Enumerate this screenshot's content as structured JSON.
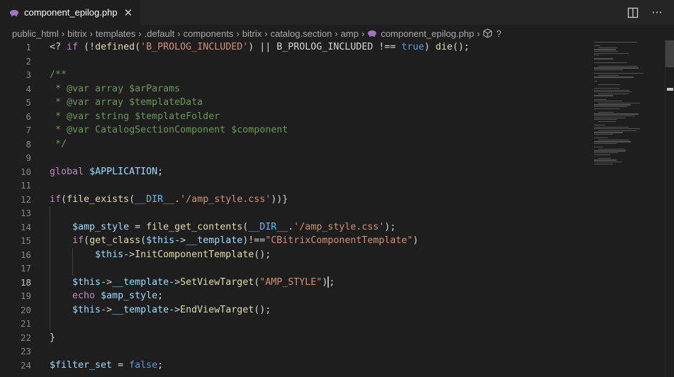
{
  "tab": {
    "label": "component_epilog.php",
    "close": "✕"
  },
  "actions": {
    "split": "split-editor",
    "more": "···"
  },
  "breadcrumb": [
    "public_html",
    "bitrix",
    "templates",
    ".default",
    "components",
    "bitrix",
    "catalog.section",
    "amp",
    "component_epilog.php",
    "?"
  ],
  "lines": [
    {
      "n": "1",
      "tokens": [
        [
          "plain",
          "<? "
        ],
        [
          "kw",
          "if"
        ],
        [
          "plain",
          " (!"
        ],
        [
          "fn",
          "defined"
        ],
        [
          "plain",
          "("
        ],
        [
          "str",
          "'B_PROLOG_INCLUDED'"
        ],
        [
          "plain",
          ") || B_PROLOG_INCLUDED !== "
        ],
        [
          "bool",
          "true"
        ],
        [
          "plain",
          ") "
        ],
        [
          "fn",
          "die"
        ],
        [
          "plain",
          "();"
        ]
      ]
    },
    {
      "n": "2",
      "tokens": []
    },
    {
      "n": "3",
      "tokens": [
        [
          "com",
          "/**"
        ]
      ]
    },
    {
      "n": "4",
      "tokens": [
        [
          "com",
          " * @var array $arParams"
        ]
      ]
    },
    {
      "n": "5",
      "tokens": [
        [
          "com",
          " * @var array $templateData"
        ]
      ]
    },
    {
      "n": "6",
      "tokens": [
        [
          "com",
          " * @var string $templateFolder"
        ]
      ]
    },
    {
      "n": "7",
      "tokens": [
        [
          "com",
          " * @var CatalogSectionComponent $component"
        ]
      ]
    },
    {
      "n": "8",
      "tokens": [
        [
          "com",
          " */"
        ]
      ]
    },
    {
      "n": "9",
      "tokens": []
    },
    {
      "n": "10",
      "tokens": [
        [
          "kw",
          "global"
        ],
        [
          "plain",
          " "
        ],
        [
          "var",
          "$APPLICATION"
        ],
        [
          "plain",
          ";"
        ]
      ]
    },
    {
      "n": "11",
      "tokens": []
    },
    {
      "n": "12",
      "tokens": [
        [
          "kw",
          "if"
        ],
        [
          "plain",
          "("
        ],
        [
          "fn",
          "file_exists"
        ],
        [
          "plain",
          "("
        ],
        [
          "cons",
          "__DIR__"
        ],
        [
          "plain",
          "."
        ],
        [
          "str",
          "'/amp_style.css'"
        ],
        [
          "plain",
          "))}"
        ]
      ]
    },
    {
      "n": "13",
      "tokens": []
    },
    {
      "n": "14",
      "tokens": [
        [
          "plain",
          "    "
        ],
        [
          "var",
          "$amp_style"
        ],
        [
          "plain",
          " = "
        ],
        [
          "fn",
          "file_get_contents"
        ],
        [
          "plain",
          "("
        ],
        [
          "cons",
          "__DIR__"
        ],
        [
          "plain",
          "."
        ],
        [
          "str",
          "'/amp_style.css'"
        ],
        [
          "plain",
          ");"
        ]
      ]
    },
    {
      "n": "15",
      "tokens": [
        [
          "plain",
          "    "
        ],
        [
          "kw",
          "if"
        ],
        [
          "plain",
          "("
        ],
        [
          "fn",
          "get_class"
        ],
        [
          "plain",
          "("
        ],
        [
          "var",
          "$this"
        ],
        [
          "plain",
          "->"
        ],
        [
          "var",
          "__template"
        ],
        [
          "plain",
          ")!=="
        ],
        [
          "str",
          "\"CBitrixComponentTemplate\""
        ],
        [
          "plain",
          ")"
        ]
      ]
    },
    {
      "n": "16",
      "tokens": [
        [
          "plain",
          "        "
        ],
        [
          "var",
          "$this"
        ],
        [
          "plain",
          "->"
        ],
        [
          "fn",
          "InitComponentTemplate"
        ],
        [
          "plain",
          "();"
        ]
      ]
    },
    {
      "n": "17",
      "tokens": []
    },
    {
      "n": "18",
      "tokens": [
        [
          "plain",
          "    "
        ],
        [
          "var",
          "$this"
        ],
        [
          "plain",
          "->"
        ],
        [
          "var",
          "__template"
        ],
        [
          "plain",
          "->"
        ],
        [
          "fn",
          "SetViewTarget"
        ],
        [
          "plain",
          "("
        ],
        [
          "str",
          "\"AMP_STYLE\""
        ],
        [
          "plain",
          ")"
        ],
        [
          "cursor",
          ""
        ],
        [
          "plain",
          ";"
        ]
      ]
    },
    {
      "n": "19",
      "tokens": [
        [
          "plain",
          "    "
        ],
        [
          "kw",
          "echo"
        ],
        [
          "plain",
          " "
        ],
        [
          "var",
          "$amp_style"
        ],
        [
          "plain",
          ";"
        ]
      ]
    },
    {
      "n": "20",
      "tokens": [
        [
          "plain",
          "    "
        ],
        [
          "var",
          "$this"
        ],
        [
          "plain",
          "->"
        ],
        [
          "var",
          "__template"
        ],
        [
          "plain",
          "->"
        ],
        [
          "fn",
          "EndViewTarget"
        ],
        [
          "plain",
          "();"
        ]
      ]
    },
    {
      "n": "21",
      "tokens": []
    },
    {
      "n": "22",
      "tokens": [
        [
          "plain",
          "}"
        ]
      ]
    },
    {
      "n": "23",
      "tokens": []
    },
    {
      "n": "24",
      "tokens": [
        [
          "var",
          "$filter_set"
        ],
        [
          "plain",
          " = "
        ],
        [
          "bool",
          "false"
        ],
        [
          "plain",
          ";"
        ]
      ]
    }
  ],
  "colors": {
    "background": "#1e1e1e",
    "tabbar": "#252526",
    "keyword": "#c586c0",
    "function": "#dcdcaa",
    "string": "#ce9178",
    "variable": "#9cdcfe",
    "comment": "#6a9955"
  }
}
